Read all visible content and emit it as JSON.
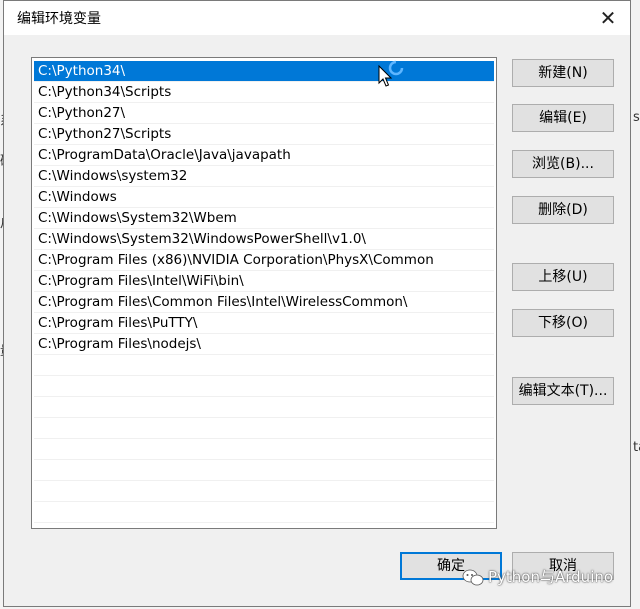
{
  "dialog": {
    "title": "编辑环境变量",
    "close_glyph": "✕"
  },
  "path_list": {
    "items": [
      "C:\\Python34\\",
      "C:\\Python34\\Scripts",
      "C:\\Python27\\",
      "C:\\Python27\\Scripts",
      "C:\\ProgramData\\Oracle\\Java\\javapath",
      "C:\\Windows\\system32",
      "C:\\Windows",
      "C:\\Windows\\System32\\Wbem",
      "C:\\Windows\\System32\\WindowsPowerShell\\v1.0\\",
      "C:\\Program Files (x86)\\NVIDIA Corporation\\PhysX\\Common",
      "C:\\Program Files\\Intel\\WiFi\\bin\\",
      "C:\\Program Files\\Common Files\\Intel\\WirelessCommon\\",
      "C:\\Program Files\\PuTTY\\",
      "C:\\Program Files\\nodejs\\"
    ],
    "selected_index": 0
  },
  "buttons": {
    "new": "新建(N)",
    "edit": "编辑(E)",
    "browse": "浏览(B)...",
    "delete": "删除(D)",
    "move_up": "上移(U)",
    "move_down": "下移(O)",
    "edit_text": "编辑文本(T)...",
    "ok": "确定",
    "cancel": "取消"
  },
  "background_fragments": [
    "系统",
    "硕",
    "户",
    "量",
    "s;",
    "ta"
  ],
  "watermark": {
    "text": "Python与Arduino",
    "icon": "wechat-icon"
  },
  "colors": {
    "selection": "#0078d7",
    "default_button_border": "#0078d7"
  }
}
